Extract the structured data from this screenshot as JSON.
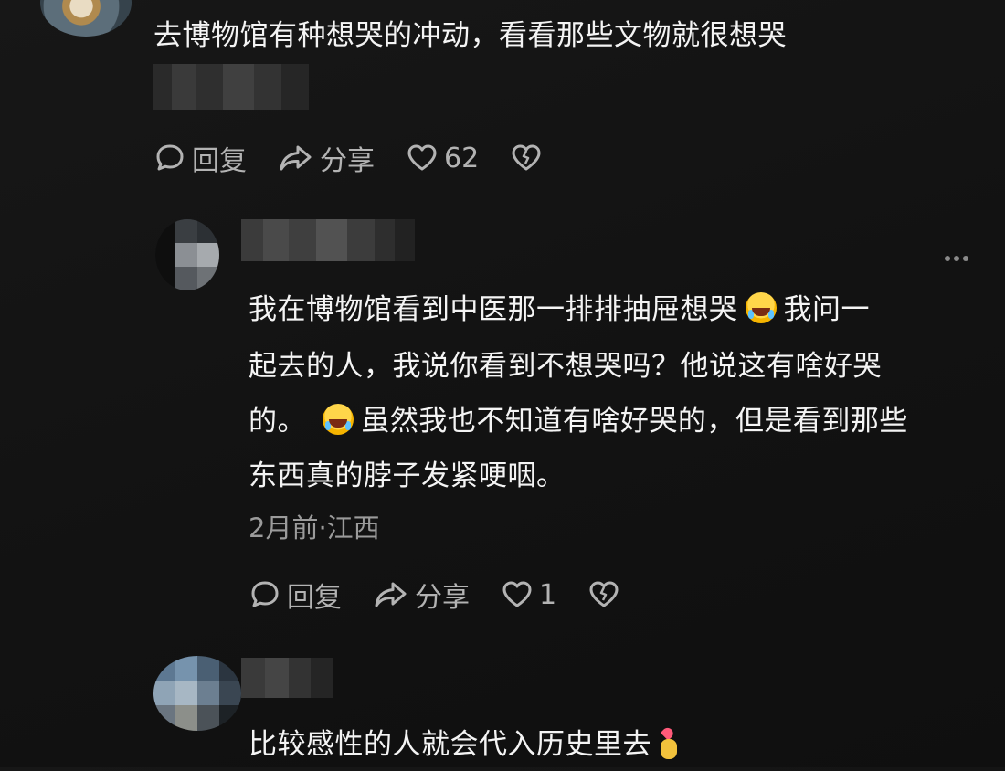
{
  "comment_top": {
    "text": "去博物馆有种想哭的冲动，看看那些文物就很想哭",
    "actions": {
      "reply_label": "回复",
      "share_label": "分享",
      "like_count": "62"
    }
  },
  "reply": {
    "line1": "我在博物馆看到中医那一排排抽屉想哭",
    "line1_after": "我问一",
    "line2": "起去的人，我说你看到不想哭吗？他说这有啥好哭",
    "line3_before": "的。",
    "line3_after": "虽然我也不知道有啥好哭的，但是看到那些",
    "line4": "东西真的脖子发紧哽咽。",
    "meta": "2月前·江西",
    "actions": {
      "reply_label": "回复",
      "share_label": "分享",
      "like_count": "1"
    }
  },
  "comment_third": {
    "text": "比较感性的人就会代入历史里去"
  },
  "icons": {
    "reply": "speech-bubble-icon",
    "share": "share-arrow-icon",
    "like": "heart-icon",
    "dislike": "broken-heart-icon",
    "more": "more-dots-icon",
    "emoji_laugh": "rolling-laughing-emoji",
    "emoji_heart_hand": "finger-heart-emoji"
  },
  "colors": {
    "background": "#141414",
    "text": "#f4f4f4",
    "secondary": "#9b9b9b",
    "action": "#b3b3b3"
  }
}
